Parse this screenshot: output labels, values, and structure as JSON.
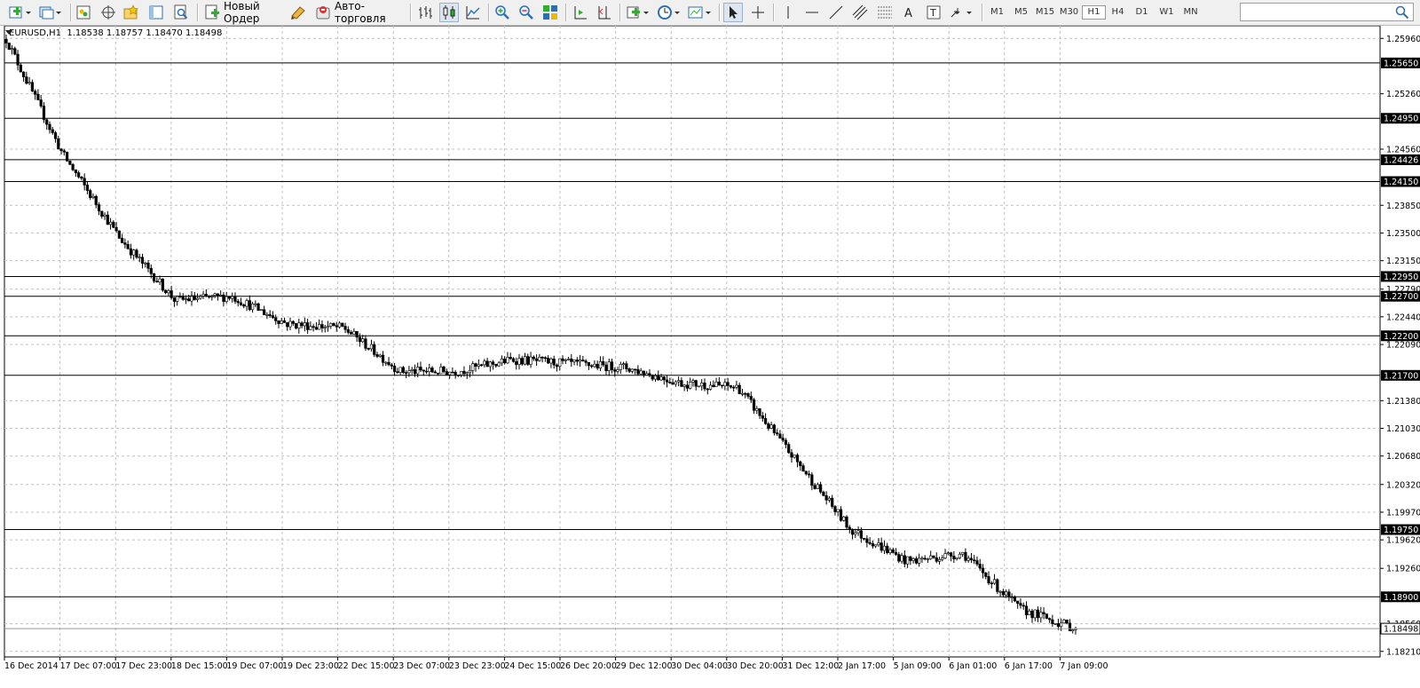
{
  "toolbar": {
    "new_order_label": "Новый Ордер",
    "autotrading_label": "Авто-торговля",
    "timeframes": [
      "M1",
      "M5",
      "M15",
      "M30",
      "H1",
      "H4",
      "D1",
      "W1",
      "MN"
    ],
    "active_timeframe": "H1",
    "search_placeholder": ""
  },
  "chart": {
    "symbol_line": "EURUSD,H1  1.18538 1.18757 1.18470 1.18498",
    "current_price": "1.18498",
    "price_labels": [
      "1.25960",
      "1.25260",
      "1.24560",
      "1.23850",
      "1.23500",
      "1.23150",
      "1.22790",
      "1.22440",
      "1.22090",
      "1.21380",
      "1.21030",
      "1.20680",
      "1.20320",
      "1.19970",
      "1.19620",
      "1.19260",
      "1.18560",
      "1.18210"
    ],
    "levels": [
      "1.25650",
      "1.24950",
      "1.24426",
      "1.24150",
      "1.22950",
      "1.22700",
      "1.22200",
      "1.21700",
      "1.19750",
      "1.18900"
    ],
    "time_labels": [
      "16 Dec 2014",
      "17 Dec 07:00",
      "17 Dec 23:00",
      "18 Dec 15:00",
      "19 Dec 07:00",
      "19 Dec 23:00",
      "22 Dec 15:00",
      "23 Dec 07:00",
      "23 Dec 23:00",
      "24 Dec 15:00",
      "26 Dec 20:00",
      "29 Dec 12:00",
      "30 Dec 04:00",
      "30 Dec 20:00",
      "31 Dec 12:00",
      "2 Jan 17:00",
      "5 Jan 09:00",
      "6 Jan 01:00",
      "6 Jan 17:00",
      "7 Jan 09:00"
    ]
  },
  "chart_data": {
    "type": "candlestick",
    "symbol": "EURUSD",
    "timeframe": "H1",
    "last_bar": {
      "open": 1.18538,
      "high": 1.18757,
      "low": 1.1847,
      "close": 1.18498
    },
    "y_range": [
      1.1814,
      1.2612
    ],
    "grid": true,
    "horizontal_levels": [
      1.2565,
      1.2495,
      1.24426,
      1.2415,
      1.2295,
      1.227,
      1.222,
      1.217,
      1.1975,
      1.189
    ],
    "series_outline": [
      {
        "time": "16 Dec 2014",
        "price": 1.2595
      },
      {
        "time": "17 Dec 07:00",
        "price": 1.245
      },
      {
        "time": "17 Dec 23:00",
        "price": 1.2345
      },
      {
        "time": "18 Dec 15:00",
        "price": 1.2265
      },
      {
        "time": "19 Dec 07:00",
        "price": 1.227
      },
      {
        "time": "19 Dec 23:00",
        "price": 1.2235
      },
      {
        "time": "22 Dec 15:00",
        "price": 1.223
      },
      {
        "time": "23 Dec 07:00",
        "price": 1.2175
      },
      {
        "time": "23 Dec 23:00",
        "price": 1.2175
      },
      {
        "time": "24 Dec 15:00",
        "price": 1.219
      },
      {
        "time": "26 Dec 20:00",
        "price": 1.2185
      },
      {
        "time": "29 Dec 12:00",
        "price": 1.218
      },
      {
        "time": "30 Dec 04:00",
        "price": 1.216
      },
      {
        "time": "30 Dec 20:00",
        "price": 1.2155
      },
      {
        "time": "31 Dec 12:00",
        "price": 1.2065
      },
      {
        "time": "2 Jan 17:00",
        "price": 1.1975
      },
      {
        "time": "5 Jan 09:00",
        "price": 1.1935
      },
      {
        "time": "6 Jan 01:00",
        "price": 1.1945
      },
      {
        "time": "6 Jan 17:00",
        "price": 1.1875
      },
      {
        "time": "7 Jan 09:00",
        "price": 1.185
      }
    ]
  }
}
